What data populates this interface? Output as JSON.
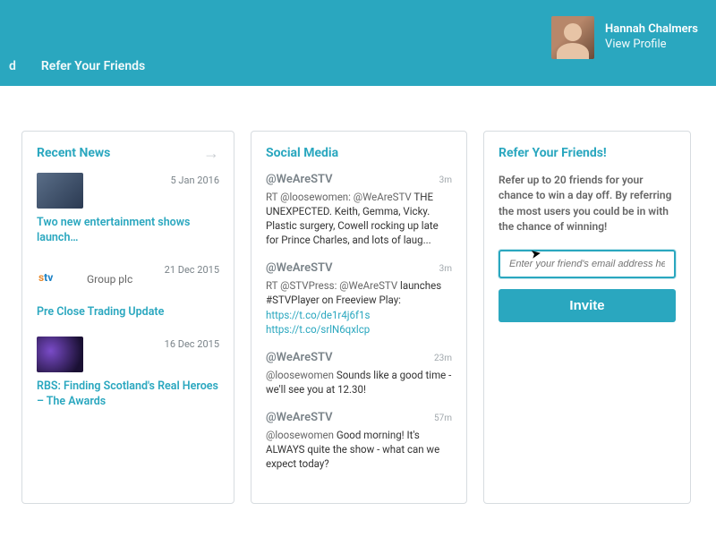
{
  "header": {
    "user_name": "Hannah Chalmers",
    "view_profile": "View Profile",
    "nav_cut": "d",
    "nav_refer": "Refer Your Friends"
  },
  "news": {
    "title": "Recent News",
    "arrow": "→",
    "items": [
      {
        "date": "5 Jan 2016",
        "title": "Two new entertainment shows launch…"
      },
      {
        "date": "21 Dec 2015",
        "title": "Pre Close Trading Update",
        "logo_stv": "stv",
        "logo_group": "Group plc"
      },
      {
        "date": "16 Dec 2015",
        "title": "RBS: Finding Scotland's Real Heroes – The Awards"
      }
    ]
  },
  "social": {
    "title": "Social Media",
    "tweets": [
      {
        "handle": "@WeAreSTV",
        "time": "3m",
        "prefix": "RT ",
        "grey1": "@loosewomen: @WeAreSTV ",
        "dark": "THE UNEXPECTED. Keith, Gemma, Vicky. Plastic surgery, Cowell rocking up late for Prince Charles, and lots of laug..."
      },
      {
        "handle": "@WeAreSTV",
        "time": "3m",
        "prefix": "RT ",
        "grey1": "@STVPress: @WeAreSTV ",
        "dark": "launches #STVPlayer on Freeview Play: ",
        "link1": "https://t.co/de1r4j6f1s",
        "link2": "https://t.co/srlN6qxlcp"
      },
      {
        "handle": "@WeAreSTV",
        "time": "23m",
        "grey1": "@loosewomen ",
        "dark": "Sounds like a good time - we'll see you at 12.30!"
      },
      {
        "handle": "@WeAreSTV",
        "time": "57m",
        "grey1": "@loosewomen ",
        "dark": "Good morning! It's ALWAYS quite the show - what can we expect today?"
      }
    ]
  },
  "refer": {
    "title": "Refer Your Friends!",
    "desc": "Refer up to 20 friends for your chance to win a day off. By referring the most users you could be in with the chance of winning!",
    "placeholder": "Enter your friend's email address here",
    "button": "Invite"
  }
}
